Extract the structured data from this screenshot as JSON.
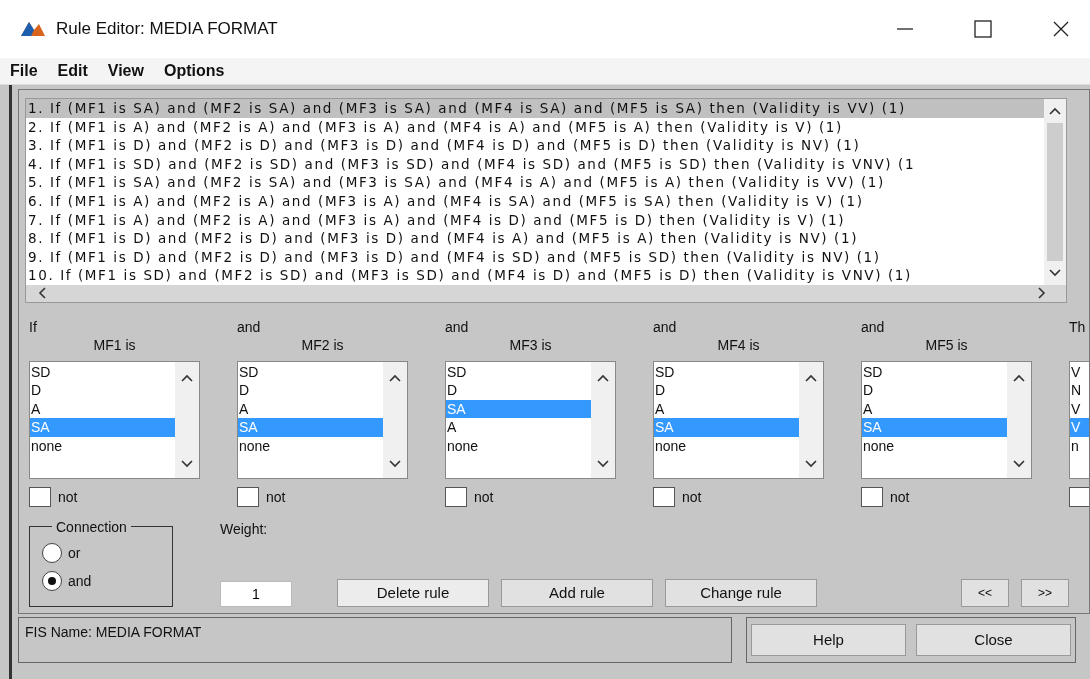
{
  "window": {
    "title": "Rule Editor: MEDIA FORMAT"
  },
  "menu": [
    "File",
    "Edit",
    "View",
    "Options"
  ],
  "rules": [
    {
      "text": "1. If (MF1 is SA) and (MF2 is SA) and (MF3 is SA) and (MF4 is SA) and (MF5 is SA) then (Validity is VV) (1)",
      "selected": true
    },
    {
      "text": "2. If (MF1 is A) and (MF2 is A) and (MF3 is A) and (MF4 is A) and (MF5 is A) then (Validity is V) (1)",
      "selected": false
    },
    {
      "text": "3. If (MF1 is D) and (MF2 is D) and (MF3 is D) and (MF4 is D) and (MF5 is D) then (Validity is NV) (1)",
      "selected": false
    },
    {
      "text": "4. If (MF1 is SD) and (MF2 is SD) and (MF3 is SD) and (MF4 is SD) and (MF5 is SD) then (Validity is VNV) (1",
      "selected": false
    },
    {
      "text": "5. If (MF1 is SA) and (MF2 is SA) and (MF3 is SA) and (MF4 is A) and (MF5 is A) then (Validity is VV) (1)",
      "selected": false
    },
    {
      "text": "6. If (MF1 is A) and (MF2 is A) and (MF3 is A) and (MF4 is SA) and (MF5 is SA) then (Validity is V) (1)",
      "selected": false
    },
    {
      "text": "7. If (MF1 is A) and (MF2 is A) and (MF3 is A) and (MF4 is D) and (MF5 is D) then (Validity is V) (1)",
      "selected": false
    },
    {
      "text": "8. If (MF1 is D) and (MF2 is D) and (MF3 is D) and (MF4 is A) and (MF5 is A) then (Validity is NV) (1)",
      "selected": false
    },
    {
      "text": "9. If (MF1 is D) and (MF2 is D) and (MF3 is D) and (MF4 is SD) and (MF5 is SD) then (Validity is NV) (1)",
      "selected": false
    },
    {
      "text": "10. If (MF1 is SD) and (MF2 is SD) and (MF3 is SD) and (MF4 is D) and (MF5 is D) then (Validity is VNV) (1)",
      "selected": false
    }
  ],
  "antecedents": [
    {
      "connector": "If",
      "label": "MF1 is",
      "not": false,
      "not_label": "not",
      "options": [
        {
          "label": "SD",
          "selected": false
        },
        {
          "label": "D",
          "selected": false
        },
        {
          "label": "A",
          "selected": false
        },
        {
          "label": "SA",
          "selected": true
        },
        {
          "label": "none",
          "selected": false
        }
      ]
    },
    {
      "connector": "and",
      "label": "MF2 is",
      "not": false,
      "not_label": "not",
      "options": [
        {
          "label": "SD",
          "selected": false
        },
        {
          "label": "D",
          "selected": false
        },
        {
          "label": "A",
          "selected": false
        },
        {
          "label": "SA",
          "selected": true
        },
        {
          "label": "none",
          "selected": false
        }
      ]
    },
    {
      "connector": "and",
      "label": "MF3 is",
      "not": false,
      "not_label": "not",
      "options": [
        {
          "label": "SD",
          "selected": false
        },
        {
          "label": "D",
          "selected": false
        },
        {
          "label": "SA",
          "selected": true
        },
        {
          "label": "A",
          "selected": false
        },
        {
          "label": "none",
          "selected": false
        }
      ]
    },
    {
      "connector": "and",
      "label": "MF4 is",
      "not": false,
      "not_label": "not",
      "options": [
        {
          "label": "SD",
          "selected": false
        },
        {
          "label": "D",
          "selected": false
        },
        {
          "label": "A",
          "selected": false
        },
        {
          "label": "SA",
          "selected": true
        },
        {
          "label": "none",
          "selected": false
        }
      ]
    },
    {
      "connector": "and",
      "label": "MF5 is",
      "not": false,
      "not_label": "not",
      "options": [
        {
          "label": "SD",
          "selected": false
        },
        {
          "label": "D",
          "selected": false
        },
        {
          "label": "A",
          "selected": false
        },
        {
          "label": "SA",
          "selected": true
        },
        {
          "label": "none",
          "selected": false
        }
      ]
    }
  ],
  "consequent": {
    "connector": "Th",
    "not": false,
    "options": [
      {
        "label": "V",
        "selected": false
      },
      {
        "label": "N",
        "selected": false
      },
      {
        "label": "V",
        "selected": false
      },
      {
        "label": "V",
        "selected": true
      },
      {
        "label": "n",
        "selected": false
      }
    ]
  },
  "connection": {
    "title": "Connection",
    "options": [
      {
        "label": "or",
        "selected": false
      },
      {
        "label": "and",
        "selected": true
      }
    ]
  },
  "weight": {
    "label": "Weight:",
    "value": "1"
  },
  "actions": [
    "Delete rule",
    "Add rule",
    "Change rule"
  ],
  "nav": [
    "<<",
    ">>"
  ],
  "status": "FIS Name: MEDIA FORMAT",
  "footer_buttons": [
    "Help",
    "Close"
  ]
}
